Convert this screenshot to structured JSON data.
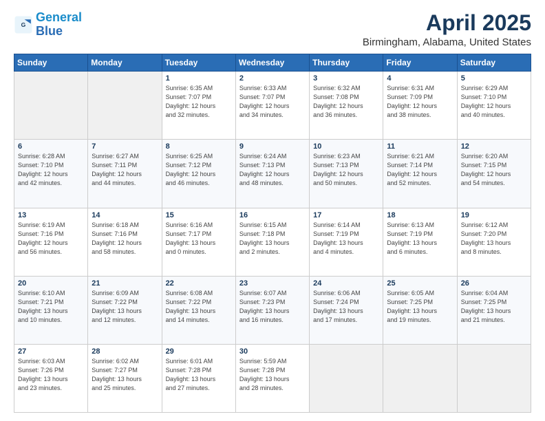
{
  "logo": {
    "line1": "General",
    "line2": "Blue"
  },
  "title": "April 2025",
  "subtitle": "Birmingham, Alabama, United States",
  "days_of_week": [
    "Sunday",
    "Monday",
    "Tuesday",
    "Wednesday",
    "Thursday",
    "Friday",
    "Saturday"
  ],
  "weeks": [
    [
      {
        "day": "",
        "sunrise": "",
        "sunset": "",
        "daylight": ""
      },
      {
        "day": "",
        "sunrise": "",
        "sunset": "",
        "daylight": ""
      },
      {
        "day": "1",
        "sunrise": "Sunrise: 6:35 AM",
        "sunset": "Sunset: 7:07 PM",
        "daylight": "Daylight: 12 hours and 32 minutes."
      },
      {
        "day": "2",
        "sunrise": "Sunrise: 6:33 AM",
        "sunset": "Sunset: 7:07 PM",
        "daylight": "Daylight: 12 hours and 34 minutes."
      },
      {
        "day": "3",
        "sunrise": "Sunrise: 6:32 AM",
        "sunset": "Sunset: 7:08 PM",
        "daylight": "Daylight: 12 hours and 36 minutes."
      },
      {
        "day": "4",
        "sunrise": "Sunrise: 6:31 AM",
        "sunset": "Sunset: 7:09 PM",
        "daylight": "Daylight: 12 hours and 38 minutes."
      },
      {
        "day": "5",
        "sunrise": "Sunrise: 6:29 AM",
        "sunset": "Sunset: 7:10 PM",
        "daylight": "Daylight: 12 hours and 40 minutes."
      }
    ],
    [
      {
        "day": "6",
        "sunrise": "Sunrise: 6:28 AM",
        "sunset": "Sunset: 7:10 PM",
        "daylight": "Daylight: 12 hours and 42 minutes."
      },
      {
        "day": "7",
        "sunrise": "Sunrise: 6:27 AM",
        "sunset": "Sunset: 7:11 PM",
        "daylight": "Daylight: 12 hours and 44 minutes."
      },
      {
        "day": "8",
        "sunrise": "Sunrise: 6:25 AM",
        "sunset": "Sunset: 7:12 PM",
        "daylight": "Daylight: 12 hours and 46 minutes."
      },
      {
        "day": "9",
        "sunrise": "Sunrise: 6:24 AM",
        "sunset": "Sunset: 7:13 PM",
        "daylight": "Daylight: 12 hours and 48 minutes."
      },
      {
        "day": "10",
        "sunrise": "Sunrise: 6:23 AM",
        "sunset": "Sunset: 7:13 PM",
        "daylight": "Daylight: 12 hours and 50 minutes."
      },
      {
        "day": "11",
        "sunrise": "Sunrise: 6:21 AM",
        "sunset": "Sunset: 7:14 PM",
        "daylight": "Daylight: 12 hours and 52 minutes."
      },
      {
        "day": "12",
        "sunrise": "Sunrise: 6:20 AM",
        "sunset": "Sunset: 7:15 PM",
        "daylight": "Daylight: 12 hours and 54 minutes."
      }
    ],
    [
      {
        "day": "13",
        "sunrise": "Sunrise: 6:19 AM",
        "sunset": "Sunset: 7:16 PM",
        "daylight": "Daylight: 12 hours and 56 minutes."
      },
      {
        "day": "14",
        "sunrise": "Sunrise: 6:18 AM",
        "sunset": "Sunset: 7:16 PM",
        "daylight": "Daylight: 12 hours and 58 minutes."
      },
      {
        "day": "15",
        "sunrise": "Sunrise: 6:16 AM",
        "sunset": "Sunset: 7:17 PM",
        "daylight": "Daylight: 13 hours and 0 minutes."
      },
      {
        "day": "16",
        "sunrise": "Sunrise: 6:15 AM",
        "sunset": "Sunset: 7:18 PM",
        "daylight": "Daylight: 13 hours and 2 minutes."
      },
      {
        "day": "17",
        "sunrise": "Sunrise: 6:14 AM",
        "sunset": "Sunset: 7:19 PM",
        "daylight": "Daylight: 13 hours and 4 minutes."
      },
      {
        "day": "18",
        "sunrise": "Sunrise: 6:13 AM",
        "sunset": "Sunset: 7:19 PM",
        "daylight": "Daylight: 13 hours and 6 minutes."
      },
      {
        "day": "19",
        "sunrise": "Sunrise: 6:12 AM",
        "sunset": "Sunset: 7:20 PM",
        "daylight": "Daylight: 13 hours and 8 minutes."
      }
    ],
    [
      {
        "day": "20",
        "sunrise": "Sunrise: 6:10 AM",
        "sunset": "Sunset: 7:21 PM",
        "daylight": "Daylight: 13 hours and 10 minutes."
      },
      {
        "day": "21",
        "sunrise": "Sunrise: 6:09 AM",
        "sunset": "Sunset: 7:22 PM",
        "daylight": "Daylight: 13 hours and 12 minutes."
      },
      {
        "day": "22",
        "sunrise": "Sunrise: 6:08 AM",
        "sunset": "Sunset: 7:22 PM",
        "daylight": "Daylight: 13 hours and 14 minutes."
      },
      {
        "day": "23",
        "sunrise": "Sunrise: 6:07 AM",
        "sunset": "Sunset: 7:23 PM",
        "daylight": "Daylight: 13 hours and 16 minutes."
      },
      {
        "day": "24",
        "sunrise": "Sunrise: 6:06 AM",
        "sunset": "Sunset: 7:24 PM",
        "daylight": "Daylight: 13 hours and 17 minutes."
      },
      {
        "day": "25",
        "sunrise": "Sunrise: 6:05 AM",
        "sunset": "Sunset: 7:25 PM",
        "daylight": "Daylight: 13 hours and 19 minutes."
      },
      {
        "day": "26",
        "sunrise": "Sunrise: 6:04 AM",
        "sunset": "Sunset: 7:25 PM",
        "daylight": "Daylight: 13 hours and 21 minutes."
      }
    ],
    [
      {
        "day": "27",
        "sunrise": "Sunrise: 6:03 AM",
        "sunset": "Sunset: 7:26 PM",
        "daylight": "Daylight: 13 hours and 23 minutes."
      },
      {
        "day": "28",
        "sunrise": "Sunrise: 6:02 AM",
        "sunset": "Sunset: 7:27 PM",
        "daylight": "Daylight: 13 hours and 25 minutes."
      },
      {
        "day": "29",
        "sunrise": "Sunrise: 6:01 AM",
        "sunset": "Sunset: 7:28 PM",
        "daylight": "Daylight: 13 hours and 27 minutes."
      },
      {
        "day": "30",
        "sunrise": "Sunrise: 5:59 AM",
        "sunset": "Sunset: 7:28 PM",
        "daylight": "Daylight: 13 hours and 28 minutes."
      },
      {
        "day": "",
        "sunrise": "",
        "sunset": "",
        "daylight": ""
      },
      {
        "day": "",
        "sunrise": "",
        "sunset": "",
        "daylight": ""
      },
      {
        "day": "",
        "sunrise": "",
        "sunset": "",
        "daylight": ""
      }
    ]
  ]
}
